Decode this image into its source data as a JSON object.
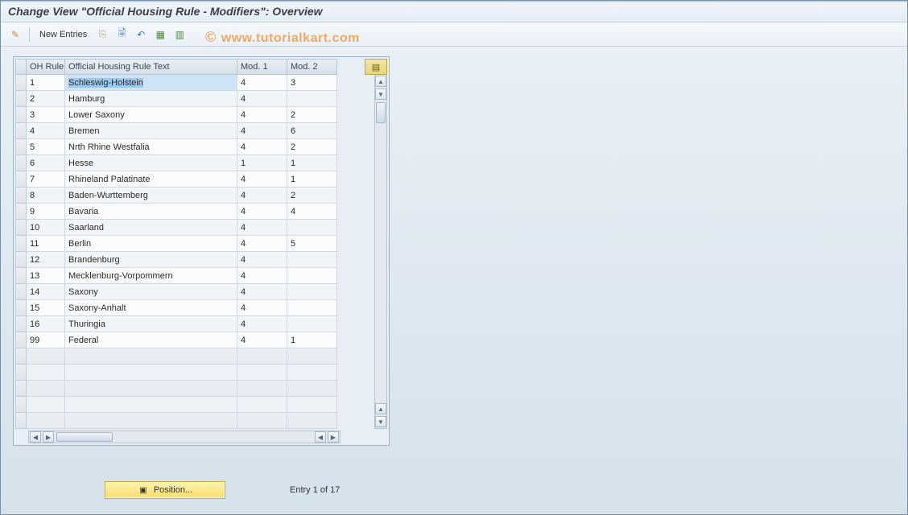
{
  "title": "Change View \"Official Housing Rule - Modifiers\": Overview",
  "toolbar": {
    "new_entries": "New Entries"
  },
  "watermark": "www.tutorialkart.com",
  "table": {
    "headers": {
      "sel": "",
      "oh_rule": "OH Rule",
      "text": "Official Housing Rule Text",
      "mod1": "Mod. 1",
      "mod2": "Mod. 2"
    },
    "rows": [
      {
        "oh_rule": "1",
        "text": "Schleswig-Holstein",
        "mod1": "4",
        "mod2": "3",
        "selected": true
      },
      {
        "oh_rule": "2",
        "text": "Hamburg",
        "mod1": "4",
        "mod2": ""
      },
      {
        "oh_rule": "3",
        "text": "Lower Saxony",
        "mod1": "4",
        "mod2": "2"
      },
      {
        "oh_rule": "4",
        "text": "Bremen",
        "mod1": "4",
        "mod2": "6"
      },
      {
        "oh_rule": "5",
        "text": "Nrth Rhine Westfalia",
        "mod1": "4",
        "mod2": "2"
      },
      {
        "oh_rule": "6",
        "text": "Hesse",
        "mod1": "1",
        "mod2": "1"
      },
      {
        "oh_rule": "7",
        "text": "Rhineland Palatinate",
        "mod1": "4",
        "mod2": "1"
      },
      {
        "oh_rule": "8",
        "text": "Baden-Wurttemberg",
        "mod1": "4",
        "mod2": "2"
      },
      {
        "oh_rule": "9",
        "text": "Bavaria",
        "mod1": "4",
        "mod2": "4"
      },
      {
        "oh_rule": "10",
        "text": "Saarland",
        "mod1": "4",
        "mod2": ""
      },
      {
        "oh_rule": "11",
        "text": "Berlin",
        "mod1": "4",
        "mod2": "5"
      },
      {
        "oh_rule": "12",
        "text": "Brandenburg",
        "mod1": "4",
        "mod2": ""
      },
      {
        "oh_rule": "13",
        "text": "Mecklenburg-Vorpommern",
        "mod1": "4",
        "mod2": ""
      },
      {
        "oh_rule": "14",
        "text": "Saxony",
        "mod1": "4",
        "mod2": ""
      },
      {
        "oh_rule": "15",
        "text": "Saxony-Anhalt",
        "mod1": "4",
        "mod2": ""
      },
      {
        "oh_rule": "16",
        "text": "Thuringia",
        "mod1": "4",
        "mod2": ""
      },
      {
        "oh_rule": "99",
        "text": "Federal",
        "mod1": "4",
        "mod2": "1"
      }
    ],
    "empty_rows": 5
  },
  "footer": {
    "position_label": "Position...",
    "entry_text": "Entry 1 of 17"
  },
  "icons": {
    "pencil": "✎",
    "copy": "📋",
    "delete": "🗑",
    "undo": "↶",
    "save": "💾",
    "select_all": "▦",
    "config": "▤",
    "up": "▲",
    "down": "▼",
    "left": "◀",
    "right": "▶",
    "pos": "▣"
  }
}
